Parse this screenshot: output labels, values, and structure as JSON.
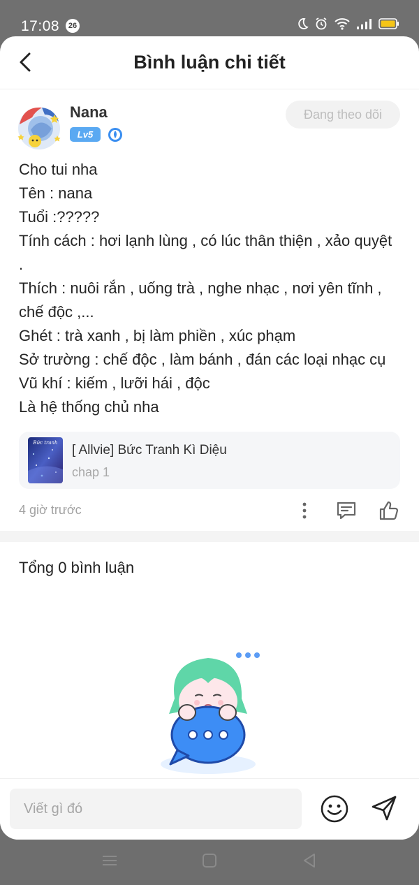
{
  "status_bar": {
    "time": "17:08",
    "notification_count": "26"
  },
  "header": {
    "title": "Bình luận chi tiết"
  },
  "post": {
    "author_name": "Nana",
    "level": "Lv5",
    "follow_label": "Đang theo dõi",
    "lines": [
      "Cho tui nha",
      "Tên : nana",
      "Tuổi :?????",
      "Tính cách : hơi lạnh lùng , có lúc thân thiện , xảo quyệt .",
      "Thích : nuôi rắn , uống trà , nghe nhạc , nơi yên tĩnh , chế độc ,...",
      "Ghét : trà xanh , bị làm phiền , xúc phạm",
      "Sở trường : chế độc , làm bánh , đán các loại nhạc cụ",
      "Vũ khí : kiếm , lưỡi hái , độc",
      "Là hệ thống chủ nha"
    ],
    "story": {
      "title": "[ Allvie] Bức Tranh Kì Diệu",
      "chapter": "chap 1",
      "cover_text": "Bức tranh"
    },
    "time_ago": "4 giờ trước"
  },
  "comments": {
    "total_label": "Tổng 0 bình luận"
  },
  "input_bar": {
    "placeholder": "Viết gì đó"
  },
  "icons": {
    "back": "chevron-left-icon",
    "more": "more-vertical-icon",
    "comment": "comment-icon",
    "like": "thumbs-up-icon",
    "emoji": "smiley-icon",
    "send": "send-icon"
  },
  "colors": {
    "level_badge": "#5aa9f2",
    "mascot_hair": "#5fd6a8",
    "mascot_bubble": "#3d8df5"
  }
}
